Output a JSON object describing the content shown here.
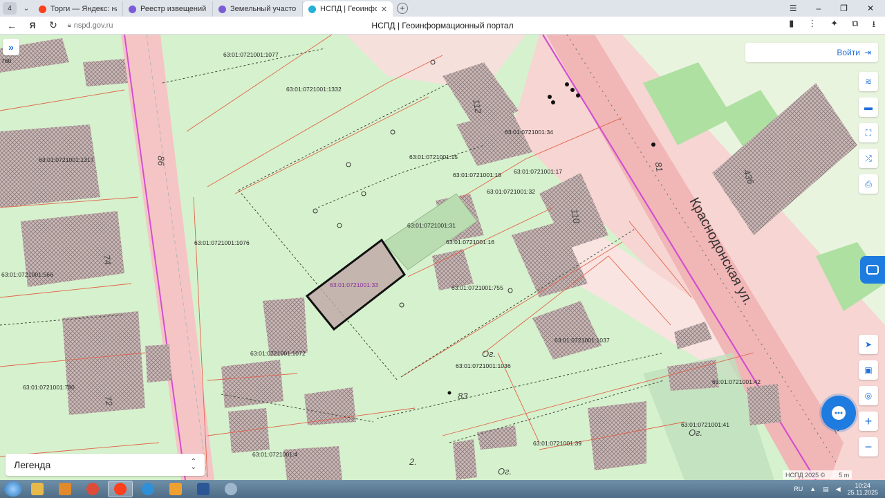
{
  "browser": {
    "tab_counter": "4",
    "tabs": [
      {
        "title": "Торги — Яндекс: нашлось",
        "active": false,
        "favicon_color": "#fc3f1d"
      },
      {
        "title": "Реестр извещений",
        "active": false,
        "favicon_color": "#7b5cd6"
      },
      {
        "title": "Земельный участок с кад",
        "active": false,
        "favicon_color": "#7b5cd6"
      },
      {
        "title": "НСПД | Геоинформац",
        "active": true,
        "favicon_color": "#26b0d8"
      }
    ],
    "url": "nspd.gov.ru",
    "page_title": "НСПД | Геоинформационный портал"
  },
  "map": {
    "edge_label": "760",
    "login_label": "Войти",
    "legend_label": "Легенда",
    "copyright": "НСПД 2025 ©",
    "scale": "5 m",
    "street_name": "Краснодонская ул.",
    "selected_parcel": "63:01:0721001:33",
    "parcel_labels": [
      "63:01:0721001:1077",
      "63:01:0721001:1332",
      "63:01:0721001:1317",
      "63:01:0721001:15",
      "63:01:0721001:34",
      "63:01:0721001:18",
      "63:01:0721001:17",
      "63:01:0721001:32",
      "63:01:0721001:31",
      "63:01:0721001:1076",
      "63:01:0721001:16",
      "63:01:0721001:566",
      "63:01:0721001:33",
      "63:01:0721001:755",
      "63:01:0721001:1037",
      "63:01:0721001:1072",
      "63:01:0721001:1036",
      "63:01:0721001:780",
      "63:01:0721001:42",
      "63:01:0721001:41",
      "63:01:0721001:39",
      "63:01:0721001:4"
    ],
    "house_numbers": [
      "86",
      "81",
      "83",
      "74",
      "72",
      "110",
      "112",
      "436",
      "Ог.",
      "Ог.",
      "Ог.",
      "2.",
      "Ог."
    ]
  },
  "taskbar": {
    "lang": "RU",
    "time": "10:24",
    "date": "25.11.2025",
    "apps": [
      {
        "name": "explorer",
        "color": "#e7b94a",
        "active": false
      },
      {
        "name": "media",
        "color": "#e08a2c",
        "active": false
      },
      {
        "name": "chrome",
        "color": "#dd4b39",
        "active": false
      },
      {
        "name": "yandex-browser",
        "color": "#fc3f1d",
        "active": true
      },
      {
        "name": "internet-explorer",
        "color": "#2f8fd8",
        "active": false
      },
      {
        "name": "outlook",
        "color": "#f0a030",
        "active": false
      },
      {
        "name": "word",
        "color": "#2b5797",
        "active": false
      },
      {
        "name": "tool",
        "color": "#9fb7cc",
        "active": false
      }
    ]
  }
}
